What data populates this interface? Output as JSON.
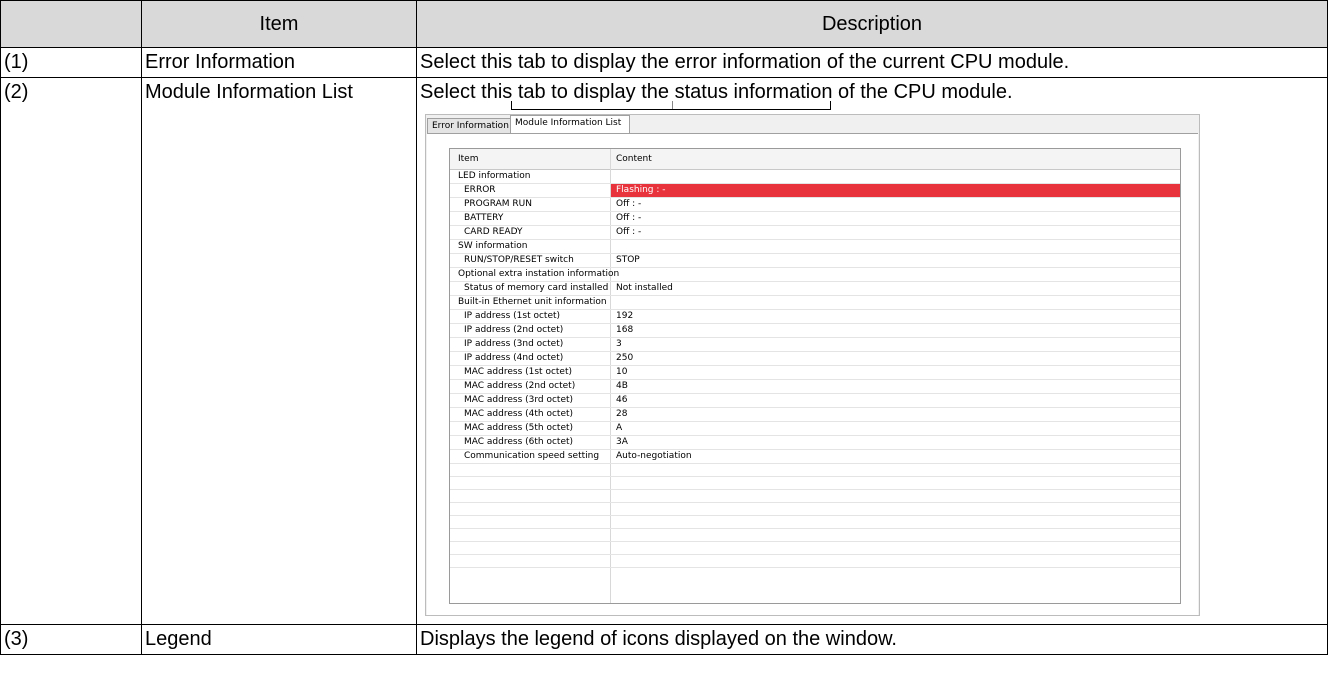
{
  "table": {
    "headers": [
      "",
      "Item",
      "Description"
    ],
    "rows": [
      {
        "num": "(1)",
        "item": "Error Information",
        "desc": "Select this tab to display the error information of the current CPU module."
      },
      {
        "num": "(2)",
        "item": "Module Information List",
        "desc": "Select this tab to display the status information of the CPU module."
      },
      {
        "num": "(3)",
        "item": "Legend",
        "desc": "Displays the legend of icons displayed on the window."
      }
    ]
  },
  "screenshot": {
    "tabs": [
      "Error Information",
      "Module Information List"
    ],
    "columns": [
      "Item",
      "Content"
    ],
    "alert_color": "#e8333c",
    "rows": [
      {
        "item": "LED information",
        "content": "",
        "level": 0
      },
      {
        "item": "ERROR",
        "content": "Flashing : -",
        "level": 1,
        "alert": true
      },
      {
        "item": "PROGRAM RUN",
        "content": "Off : -",
        "level": 1
      },
      {
        "item": "BATTERY",
        "content": "Off : -",
        "level": 1
      },
      {
        "item": "CARD READY",
        "content": "Off : -",
        "level": 1
      },
      {
        "item": "SW information",
        "content": "",
        "level": 0
      },
      {
        "item": "RUN/STOP/RESET switch",
        "content": "STOP",
        "level": 1
      },
      {
        "item": "Optional extra instation information",
        "content": "",
        "level": 0
      },
      {
        "item": "Status of memory card installed",
        "content": "Not installed",
        "level": 1
      },
      {
        "item": "Built-in Ethernet unit information",
        "content": "",
        "level": 0
      },
      {
        "item": "IP address (1st octet)",
        "content": "192",
        "level": 1
      },
      {
        "item": "IP address (2nd octet)",
        "content": "168",
        "level": 1
      },
      {
        "item": "IP address (3nd octet)",
        "content": "3",
        "level": 1
      },
      {
        "item": "IP address (4nd octet)",
        "content": "250",
        "level": 1
      },
      {
        "item": "MAC address (1st octet)",
        "content": "10",
        "level": 1
      },
      {
        "item": "MAC address (2nd octet)",
        "content": "4B",
        "level": 1
      },
      {
        "item": "MAC address (3rd octet)",
        "content": "46",
        "level": 1
      },
      {
        "item": "MAC address (4th octet)",
        "content": "28",
        "level": 1
      },
      {
        "item": "MAC address (5th octet)",
        "content": "A",
        "level": 1
      },
      {
        "item": "MAC address (6th octet)",
        "content": "3A",
        "level": 1
      },
      {
        "item": "Communication speed setting",
        "content": "Auto-negotiation",
        "level": 1
      }
    ]
  }
}
